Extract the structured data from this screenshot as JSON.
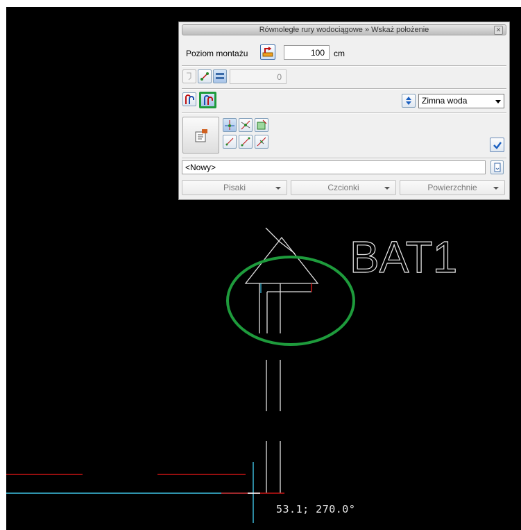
{
  "panel": {
    "title": "Równoległe rury wodociągowe » Wskaż położenie",
    "close_glyph": "✕",
    "level_label": "Poziom montażu",
    "level_value": "100",
    "level_unit": "cm",
    "count_value": "0",
    "medium_select": "Zimna woda",
    "style_select": "<Nowy>",
    "pens_label": "Pisaki",
    "fonts_label": "Czcionki",
    "surfaces_label": "Powierzchnie"
  },
  "drawing": {
    "label": "BAT1",
    "coord_readout": "53.1;  270.0°",
    "highlight_color": "#1e9b3c",
    "line_colors": {
      "white": "#e0e0e0",
      "red": "#c81414",
      "cyan": "#3fc4e6"
    }
  }
}
